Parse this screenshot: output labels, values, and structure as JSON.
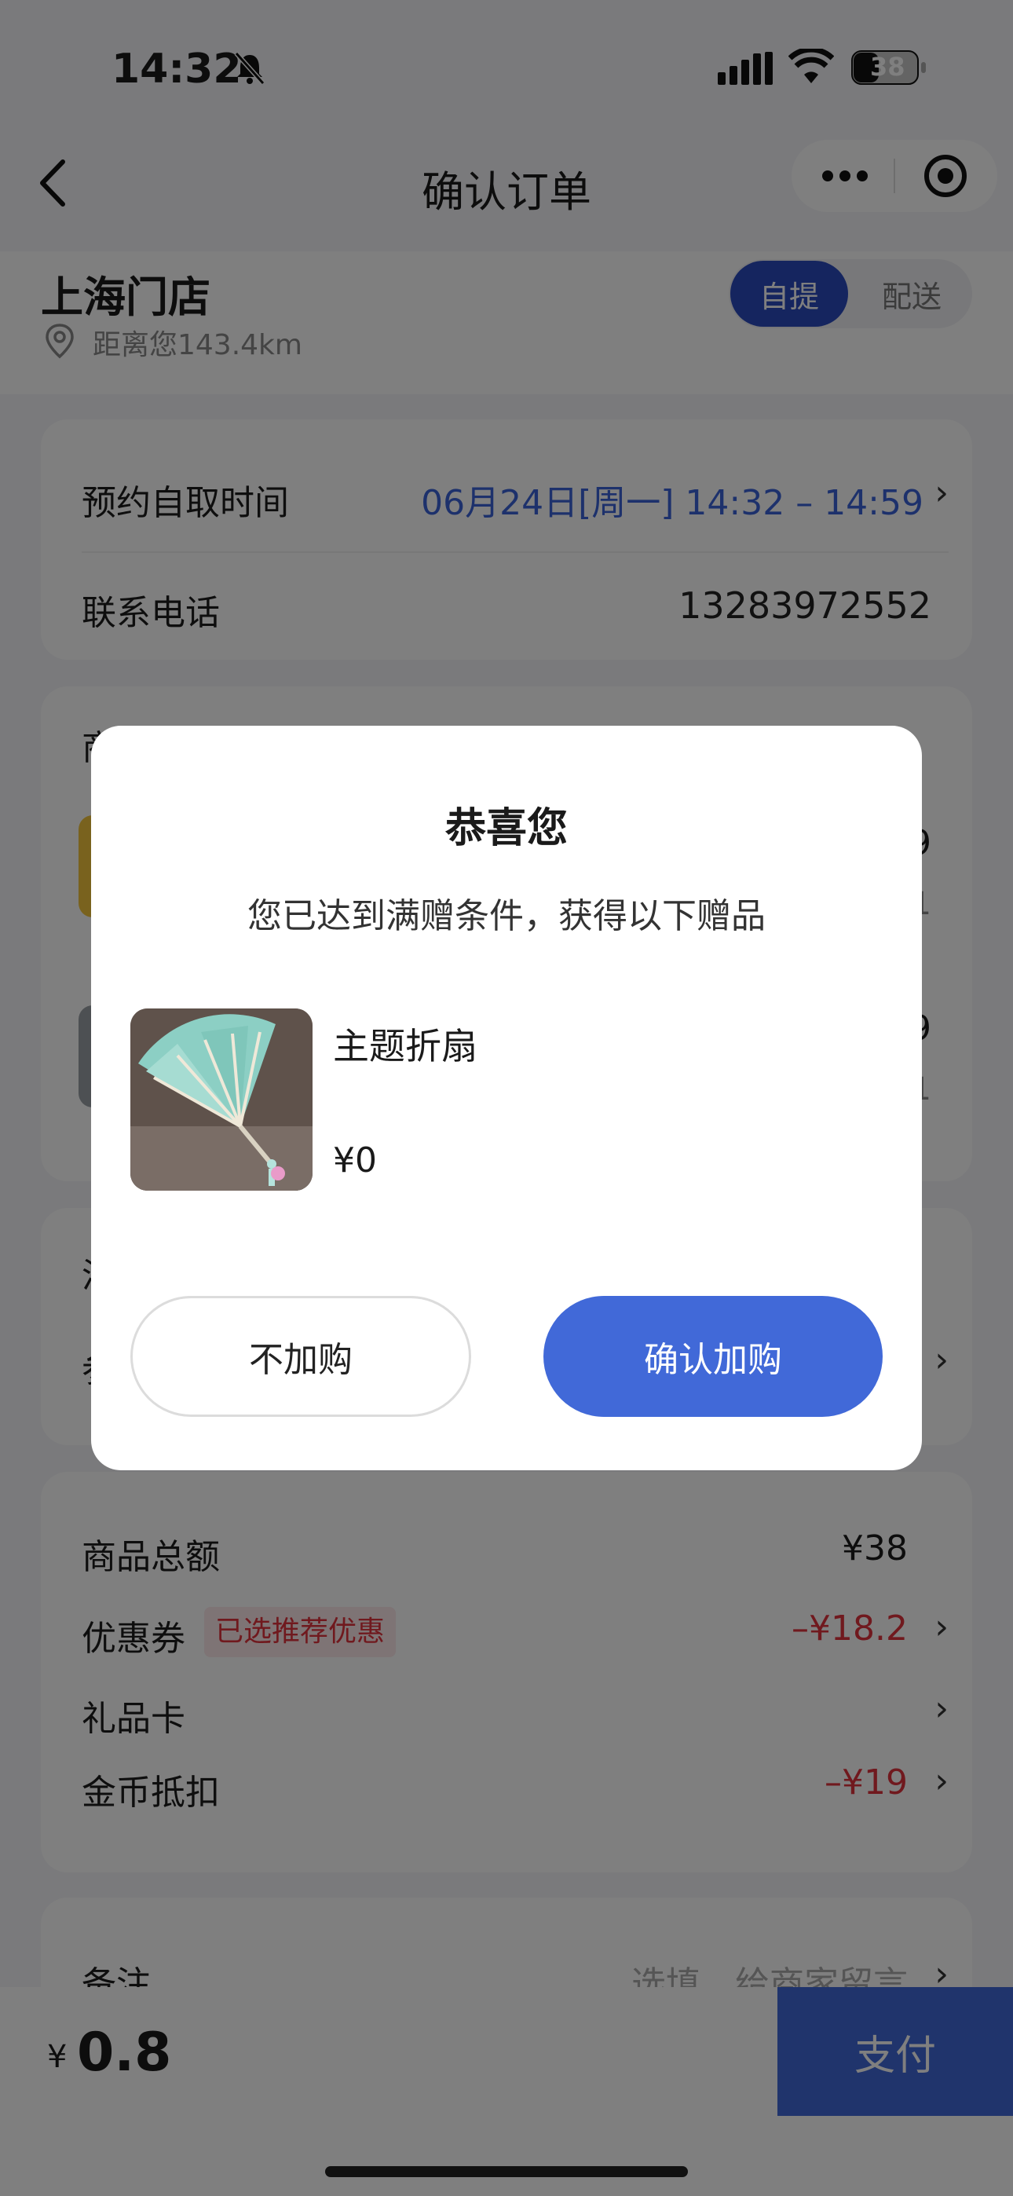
{
  "status_bar": {
    "time": "14:32",
    "battery": "38"
  },
  "nav": {
    "title": "确认订单",
    "more_icon": "more-dots-icon",
    "target_icon": "capsule-close-icon"
  },
  "store": {
    "name": "上海门店",
    "distance": "距离您143.4km",
    "mode_pickup": "自提",
    "mode_delivery": "配送"
  },
  "pickup": {
    "time_label": "预约自取时间",
    "time_value": "06月24日[周一] 14:32 – 14:59",
    "phone_label": "联系电话",
    "phone_value": "13283972552"
  },
  "goods": {
    "title_fragment": "商",
    "price_fragments": [
      "9",
      "9"
    ],
    "qty_fragments": [
      "1",
      "1"
    ]
  },
  "section3": {
    "label_fragment_1": "汽",
    "label_fragment_2": "参"
  },
  "totals": {
    "goods_total_label": "商品总额",
    "goods_total_value": "¥38",
    "coupon_label": "优惠券",
    "coupon_badge": "已选推荐优惠",
    "coupon_value": "–¥18.2",
    "giftcard_label": "礼品卡",
    "coins_label": "金币抵扣",
    "coins_value": "–¥19"
  },
  "remark": {
    "label": "备注",
    "placeholder": "选填，给商家留言"
  },
  "footer": {
    "currency": "¥",
    "amount": "0.8",
    "pay_label": "支付"
  },
  "modal": {
    "title": "恭喜您",
    "subtitle": "您已达到满赠条件，获得以下赠品",
    "gift_name": "主题折扇",
    "gift_price": "¥0",
    "decline_label": "不加购",
    "confirm_label": "确认加购"
  },
  "colors": {
    "accent": "#4169d8",
    "pickup_pill": "#2b4bbf",
    "discount_red": "#e0323c",
    "badge_bg": "#fde8ea"
  }
}
